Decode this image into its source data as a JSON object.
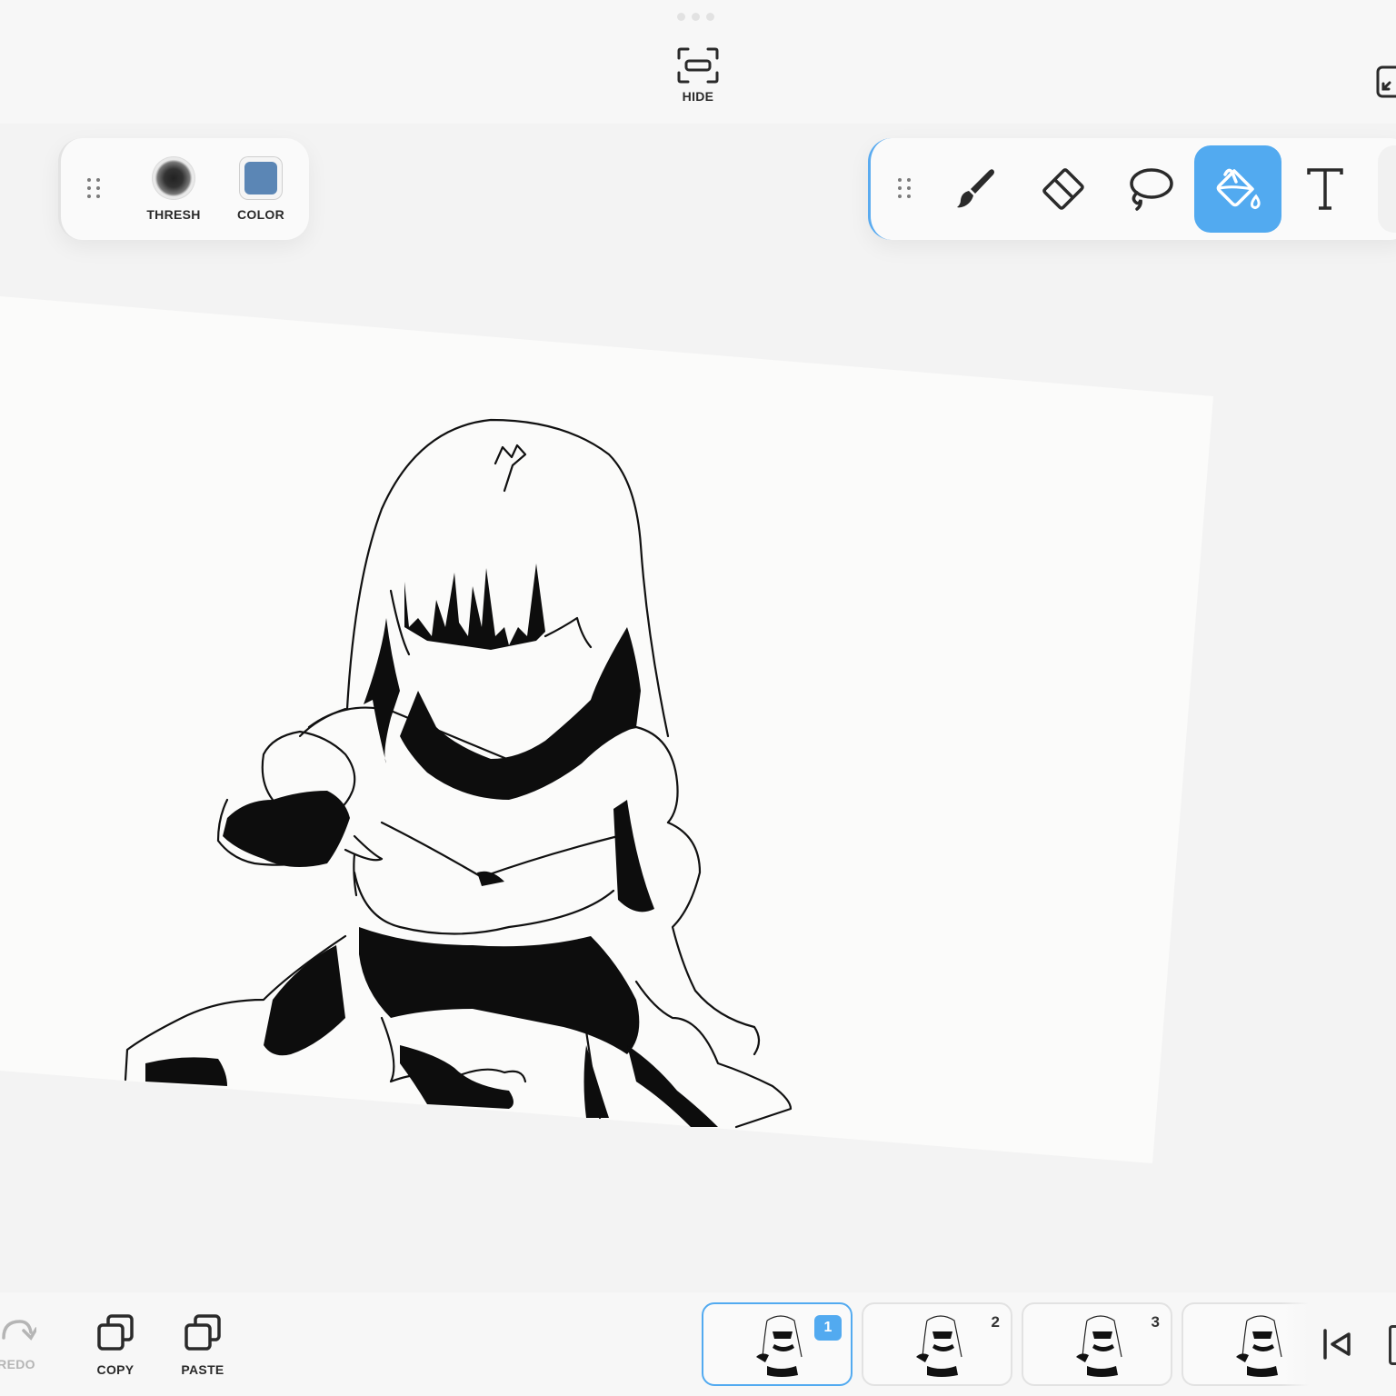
{
  "topbar": {
    "hide_label": "HIDE"
  },
  "left_panel": {
    "thresh_label": "THRESH",
    "color_label": "COLOR",
    "color_value": "#5b86b5"
  },
  "tools": [
    {
      "name": "brush",
      "icon": "brush-icon"
    },
    {
      "name": "eraser",
      "icon": "eraser-icon"
    },
    {
      "name": "lasso",
      "icon": "lasso-icon"
    },
    {
      "name": "fill",
      "icon": "paint-bucket-icon",
      "active": true
    },
    {
      "name": "text",
      "icon": "text-icon"
    }
  ],
  "bottom": {
    "redo_label": "REDO",
    "copy_label": "COPY",
    "paste_label": "PASTE",
    "frames": [
      "1",
      "2",
      "3"
    ],
    "active_frame": "1"
  },
  "colors": {
    "accent": "#52aaf0",
    "background": "#f3f3f3"
  }
}
